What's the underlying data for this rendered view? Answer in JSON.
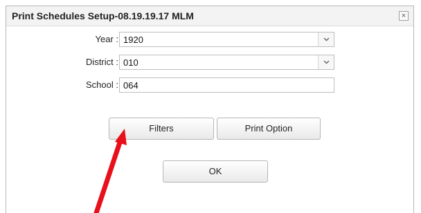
{
  "dialog": {
    "title": "Print Schedules Setup-08.19.19.17 MLM",
    "close_glyph": "×"
  },
  "form": {
    "year": {
      "label": "Year :",
      "value": "1920"
    },
    "district": {
      "label": "District :",
      "value": "010"
    },
    "school": {
      "label": "School :",
      "value": "064"
    }
  },
  "buttons": {
    "filters": "Filters",
    "print_option": "Print Option",
    "ok": "OK"
  },
  "annotation": {
    "arrow_color": "#e8101a"
  }
}
